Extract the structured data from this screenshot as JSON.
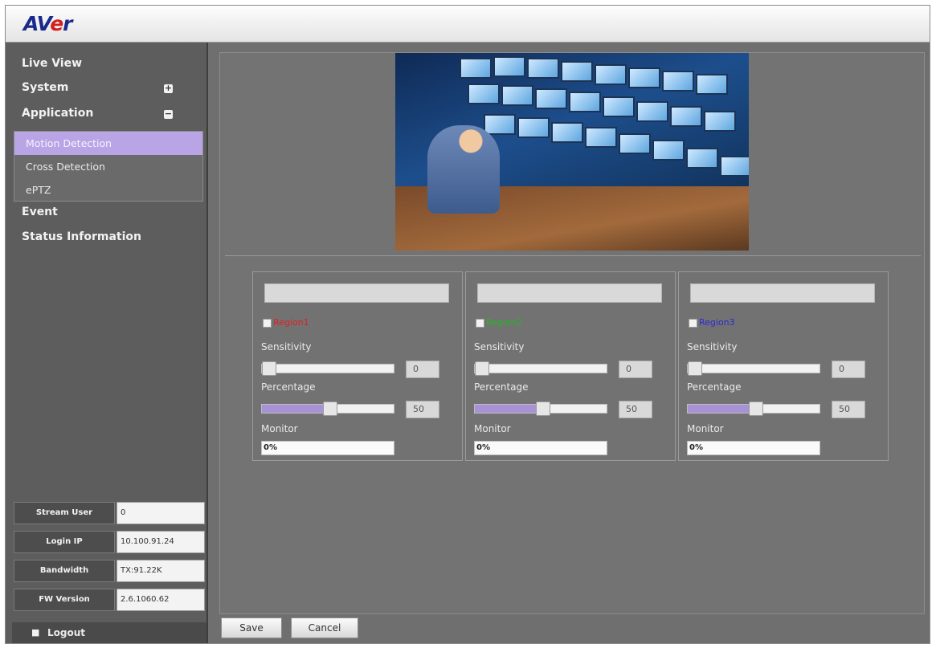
{
  "header": {
    "logo_prefix": "AV",
    "logo_e": "e",
    "logo_suffix": "r"
  },
  "sidebar": {
    "items": [
      {
        "label": "Live View"
      },
      {
        "label": "System",
        "toggle": "+"
      },
      {
        "label": "Application",
        "toggle": "−"
      },
      {
        "label": "Event"
      },
      {
        "label": "Status Information"
      }
    ],
    "submenu": [
      {
        "label": "Motion Detection",
        "active": true
      },
      {
        "label": "Cross Detection"
      },
      {
        "label": "ePTZ"
      }
    ]
  },
  "info": [
    {
      "label": "Stream User",
      "value": "0"
    },
    {
      "label": "Login IP",
      "value": "10.100.91.24"
    },
    {
      "label": "Bandwidth",
      "value": "TX:91.22K"
    },
    {
      "label": "FW Version",
      "value": "2.6.1060.62"
    }
  ],
  "logout": {
    "icon": "user-icon",
    "label": "Logout"
  },
  "regions": [
    {
      "label": "Region1",
      "color": "#e02020",
      "sensitivity_label": "Sensitivity",
      "sensitivity": "0",
      "percentage_label": "Percentage",
      "percentage": "50",
      "monitor_label": "Monitor",
      "monitor": "0%"
    },
    {
      "label": "Region2",
      "color": "#21b821",
      "sensitivity_label": "Sensitivity",
      "sensitivity": "0",
      "percentage_label": "Percentage",
      "percentage": "50",
      "monitor_label": "Monitor",
      "monitor": "0%"
    },
    {
      "label": "Region3",
      "color": "#2a2ad6",
      "sensitivity_label": "Sensitivity",
      "sensitivity": "0",
      "percentage_label": "Percentage",
      "percentage": "50",
      "monitor_label": "Monitor",
      "monitor": "0%"
    }
  ],
  "buttons": {
    "save": "Save",
    "cancel": "Cancel"
  }
}
